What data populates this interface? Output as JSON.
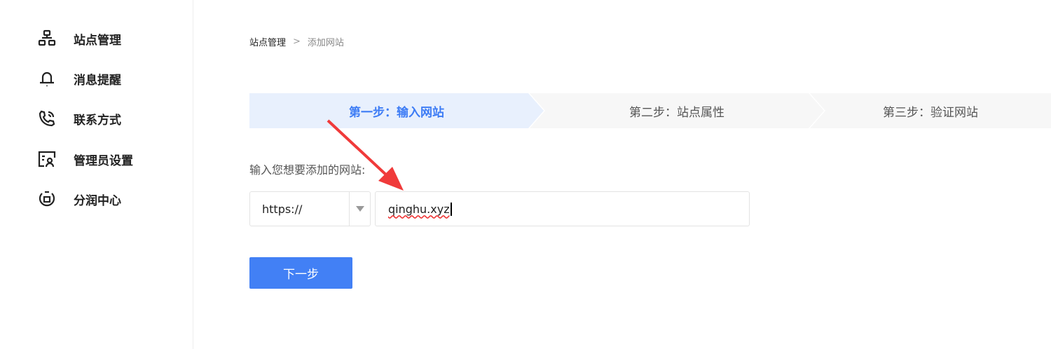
{
  "sidebar": {
    "items": [
      {
        "label": "站点管理",
        "icon": "sitemap-icon"
      },
      {
        "label": "消息提醒",
        "icon": "bell-icon"
      },
      {
        "label": "联系方式",
        "icon": "phone-icon"
      },
      {
        "label": "管理员设置",
        "icon": "admin-user-icon"
      },
      {
        "label": "分润中心",
        "icon": "revenue-icon"
      }
    ]
  },
  "breadcrumb": {
    "root": "站点管理",
    "separator": ">",
    "current": "添加网站"
  },
  "steps": [
    {
      "label": "第一步：输入网站",
      "active": true
    },
    {
      "label": "第二步：站点属性"
    },
    {
      "label": "第三步：验证网站"
    }
  ],
  "form": {
    "label": "输入您想要添加的网站:",
    "protocol": "https://",
    "url": "qinghu.xyz",
    "next_label": "下一步"
  },
  "colors": {
    "accent": "#4280f5",
    "annotation": "#f03a3a"
  }
}
